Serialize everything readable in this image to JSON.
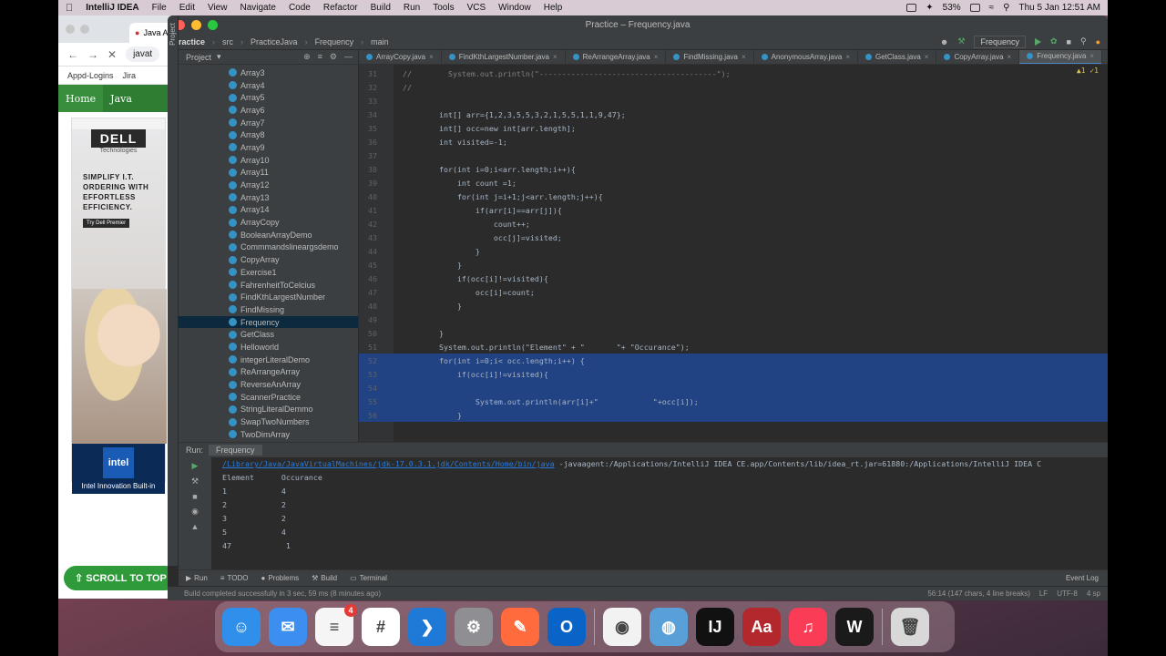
{
  "menubar": {
    "app": "IntelliJ IDEA",
    "items": [
      "File",
      "Edit",
      "View",
      "Navigate",
      "Code",
      "Refactor",
      "Build",
      "Run",
      "Tools",
      "VCS",
      "Window",
      "Help"
    ],
    "battery": "53%",
    "clock": "Thu 5 Jan  12:51 AM"
  },
  "browser": {
    "tab_title": "Java Ar",
    "url": "javat",
    "bookmarks": [
      "Appd-Logins",
      "Jira"
    ],
    "nav_home": "Home",
    "nav_java": "Java",
    "ad": {
      "brand": "DELL",
      "brand_sub": "Technologies",
      "headline": "SIMPLIFY I.T. ORDERING WITH EFFORTLESS EFFICIENCY.",
      "button": "Try Dell Premier",
      "intel_badge": "intel",
      "intel_line": "Intel Innovation Built-in"
    },
    "scroll_top": "⇧ SCROLL TO TOP"
  },
  "ide": {
    "window_title": "Practice – Frequency.java",
    "breadcrumb": [
      "Practice",
      "src",
      "PracticeJava",
      "Frequency",
      "main"
    ],
    "run_config": "Frequency",
    "project_label": "Project",
    "tree": [
      "Array3",
      "Array4",
      "Array5",
      "Array6",
      "Array7",
      "Array8",
      "Array9",
      "Array10",
      "Array11",
      "Array12",
      "Array13",
      "Array14",
      "ArrayCopy",
      "BooleanArrayDemo",
      "Commmandslineargsdemo",
      "CopyArray",
      "Exercise1",
      "FahrenheitToCelcius",
      "FindKthLargestNumber",
      "FindMissing",
      "Frequency",
      "GetClass",
      "Helloworld",
      "integerLiteralDemo",
      "ReArrangeArray",
      "ReverseAnArray",
      "ScannerPractice",
      "StringLiteralDemmo",
      "SwapTwoNumbers",
      "TwoDimArray"
    ],
    "selected_tree_item": "Frequency",
    "tabs": [
      "ArrayCopy.java",
      "FindKthLargestNumber.java",
      "ReArrangeArray.java",
      "FindMissing.java",
      "AnonymousArray.java",
      "GetClass.java",
      "CopyArray.java",
      "Frequency.java"
    ],
    "active_tab": "Frequency.java",
    "inspections": "▲1 ✓1",
    "code_lines": [
      {
        "n": "31",
        "t": "//        System.out.println(\"---------------------------------------\");",
        "hl": false
      },
      {
        "n": "32",
        "t": "//",
        "hl": false
      },
      {
        "n": "33",
        "t": "",
        "hl": false
      },
      {
        "n": "34",
        "t": "        int[] arr={1,2,3,5,5,3,2,1,5,5,1,1,9,47};",
        "hl": false
      },
      {
        "n": "35",
        "t": "        int[] occ=new int[arr.length];",
        "hl": false
      },
      {
        "n": "36",
        "t": "        int visited=-1;",
        "hl": false
      },
      {
        "n": "37",
        "t": "",
        "hl": false
      },
      {
        "n": "38",
        "t": "        for(int i=0;i<arr.length;i++){",
        "hl": false
      },
      {
        "n": "39",
        "t": "            int count =1;",
        "hl": false
      },
      {
        "n": "40",
        "t": "            for(int j=i+1;j<arr.length;j++){",
        "hl": false
      },
      {
        "n": "41",
        "t": "                if(arr[i]==arr[j]){",
        "hl": false
      },
      {
        "n": "42",
        "t": "                    count++;",
        "hl": false
      },
      {
        "n": "43",
        "t": "                    occ[j]=visited;",
        "hl": false
      },
      {
        "n": "44",
        "t": "                }",
        "hl": false
      },
      {
        "n": "45",
        "t": "            }",
        "hl": false
      },
      {
        "n": "46",
        "t": "            if(occ[i]!=visited){",
        "hl": false
      },
      {
        "n": "47",
        "t": "                occ[i]=count;",
        "hl": false
      },
      {
        "n": "48",
        "t": "            }",
        "hl": false
      },
      {
        "n": "49",
        "t": "",
        "hl": false
      },
      {
        "n": "50",
        "t": "        }",
        "hl": false
      },
      {
        "n": "51",
        "t": "        System.out.println(\"Element\" + \"       \"+ \"Occurance\");",
        "hl": false
      },
      {
        "n": "52",
        "t": "        for(int i=0;i< occ.length;i++) {",
        "hl": true
      },
      {
        "n": "53",
        "t": "            if(occ[i]!=visited){",
        "hl": true
      },
      {
        "n": "54",
        "t": "",
        "hl": true
      },
      {
        "n": "55",
        "t": "                System.out.println(arr[i]+\"            \"+occ[i]);",
        "hl": true
      },
      {
        "n": "56",
        "t": "            }",
        "hl": true
      }
    ],
    "run_panel": {
      "label": "Run:",
      "tab": "Frequency",
      "command_path": "/Library/Java/JavaVirtualMachines/jdk-17.0.3.1.jdk/Contents/Home/bin/java",
      "command_rest": " -javaagent:/Applications/IntelliJ IDEA CE.app/Contents/lib/idea_rt.jar=61880:/Applications/IntelliJ IDEA C",
      "output": [
        "Element      Occurance",
        "1            4",
        "2            2",
        "3            2",
        "5            4",
        "47            1"
      ]
    },
    "bottom_tabs": [
      "Run",
      "TODO",
      "Problems",
      "Build",
      "Terminal"
    ],
    "event_log": "Event Log",
    "status_message": "Build completed successfully in 3 sec, 59 ms (8 minutes ago)",
    "status_right": [
      "56:14 (147 chars, 4 line breaks)",
      "LF",
      "UTF-8",
      "4 sp"
    ]
  },
  "dock": {
    "apps": [
      {
        "name": "Finder",
        "label": "☺",
        "color": "#2f8fea"
      },
      {
        "name": "Mail",
        "label": "✉",
        "color": "#3c8ef0"
      },
      {
        "name": "Reminders",
        "label": "≡",
        "color": "#f5f5f5",
        "badge": "4"
      },
      {
        "name": "Slack",
        "label": "#",
        "color": "#ffffff"
      },
      {
        "name": "VS Code",
        "label": "❯",
        "color": "#1e7ad6"
      },
      {
        "name": "System Preferences",
        "label": "⚙",
        "color": "#8e8e93"
      },
      {
        "name": "Paw",
        "label": "✎",
        "color": "#ff6b3d"
      },
      {
        "name": "Outlook",
        "label": "O",
        "color": "#0a64c8"
      },
      {
        "name": "Chrome",
        "label": "◉",
        "color": "#f2f2f2"
      },
      {
        "name": "Safari-like",
        "label": "◍",
        "color": "#5aa0d8"
      },
      {
        "name": "IntelliJ IDEA",
        "label": "IJ",
        "color": "#111111"
      },
      {
        "name": "Dictionary",
        "label": "Aa",
        "color": "#b3282d"
      },
      {
        "name": "Music",
        "label": "♫",
        "color": "#fb3c56"
      },
      {
        "name": "Webex",
        "label": "W",
        "color": "#1a1a1a"
      },
      {
        "name": "Trash",
        "label": "🗑",
        "color": "#d8d8d8"
      }
    ]
  }
}
